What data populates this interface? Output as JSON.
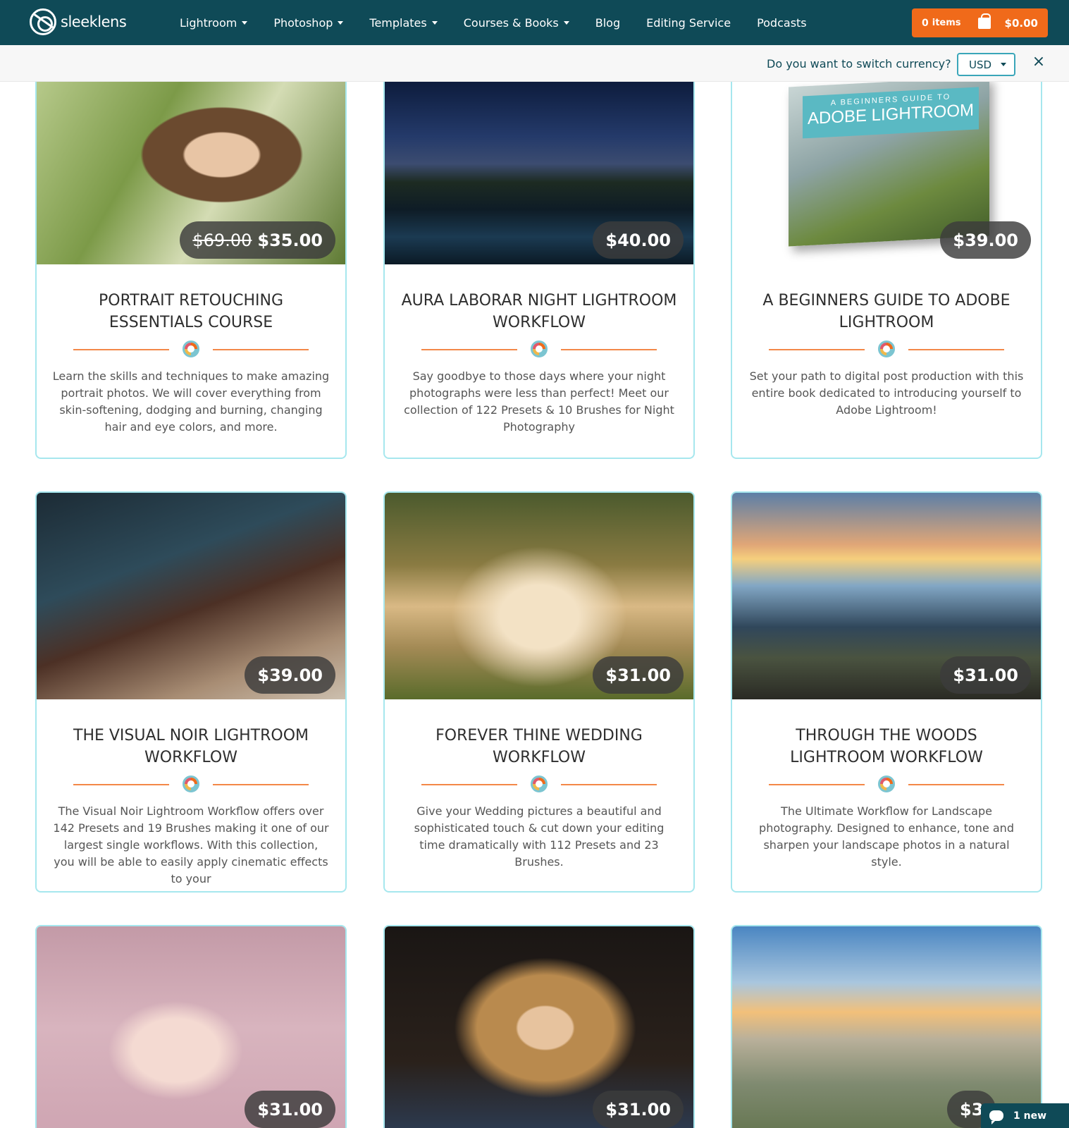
{
  "header": {
    "logo_text": "sleeklens",
    "nav": [
      "Lightroom",
      "Photoshop",
      "Templates",
      "Courses & Books",
      "Blog",
      "Editing Service",
      "Podcasts"
    ],
    "cart": {
      "count": "0",
      "items_label": "items",
      "total": "$0.00"
    }
  },
  "currency": {
    "question": "Do you want to switch currency?",
    "selected": "USD",
    "close": "×"
  },
  "products": [
    {
      "title": "PORTRAIT RETOUCHING ESSENTIALS COURSE",
      "old_price": "$69.00",
      "price": "$35.00",
      "description": "Learn the skills and techniques to make amazing portrait photos. We will cover everything from skin-softening, dodging and burning, changing hair and eye colors, and more."
    },
    {
      "title": "AURA LABORAR NIGHT LIGHTROOM WORKFLOW",
      "price": "$40.00",
      "description": "Say goodbye to those days where your night photographs were less than perfect! Meet our collection of 122 Presets & 10 Brushes for Night Photography"
    },
    {
      "title": "A BEGINNERS GUIDE TO ADOBE LIGHTROOM",
      "price": "$39.00",
      "description": "Set your path to digital post production with this entire book dedicated to introducing yourself to Adobe Lightroom!"
    },
    {
      "title": "THE VISUAL NOIR LIGHTROOM WORKFLOW",
      "price": "$39.00",
      "description": "The Visual Noir Lightroom Workflow offers over 142 Presets and 19 Brushes making it one of our largest single workflows. With this collection, you will be able to easily apply cinematic effects to your"
    },
    {
      "title": "FOREVER THINE WEDDING WORKFLOW",
      "price": "$31.00",
      "description": "Give your Wedding pictures a beautiful and sophisticated touch & cut down your editing time dramatically with 112 Presets and 23 Brushes."
    },
    {
      "title": "THROUGH THE WOODS LIGHTROOM WORKFLOW",
      "price": "$31.00",
      "description": "The Ultimate Workflow for Landscape photography. Designed to enhance, tone and sharpen your landscape photos in a natural style."
    },
    {
      "price": "$31.00"
    },
    {
      "price": "$31.00"
    },
    {
      "price": "$3"
    }
  ],
  "book_cover": {
    "small": "A BEGINNERS GUIDE TO",
    "big": "ADOBE LIGHTROOM"
  },
  "chat": {
    "label": "1 new"
  },
  "colors": {
    "header_bg": "#0f4a57",
    "accent": "#f06a1a",
    "card_border": "#a6e7ee"
  }
}
